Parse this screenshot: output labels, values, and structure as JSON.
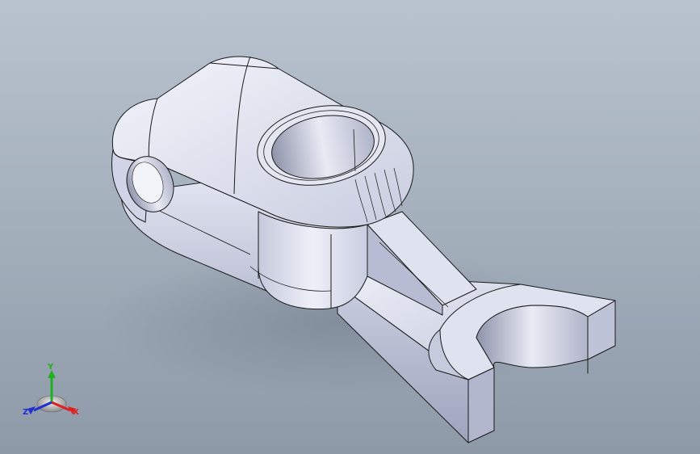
{
  "viewport": {
    "background_top": "#b9c3cf",
    "background_bottom": "#8e9aa8",
    "part_color": "#d3d7e8",
    "edge_color": "#1a1a1a"
  },
  "triad": {
    "x_label": "X",
    "y_label": "Y",
    "z_label": "Z",
    "x_color": "#e02020",
    "y_color": "#20b020",
    "z_color": "#2030d0"
  }
}
